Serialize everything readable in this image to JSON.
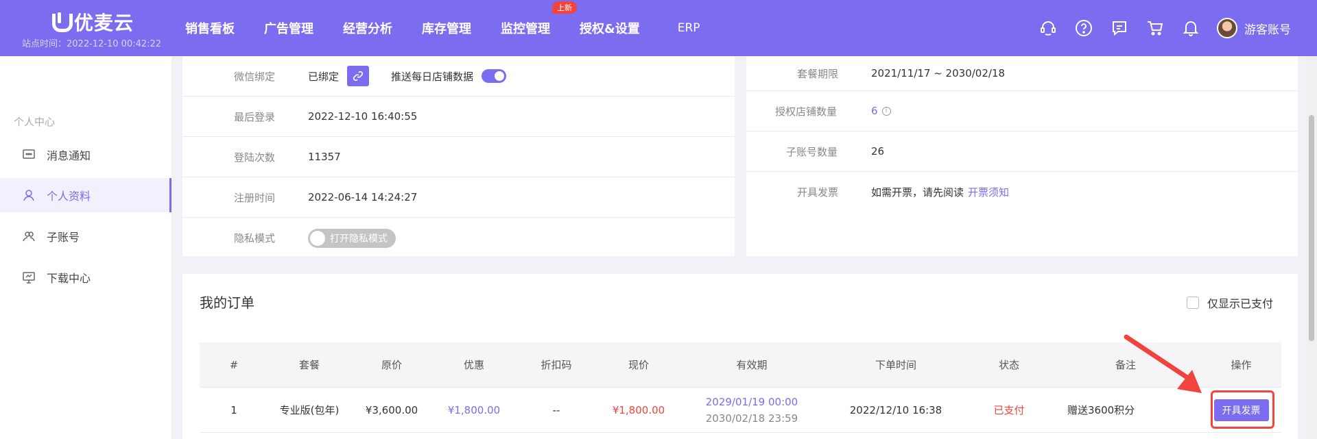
{
  "header": {
    "logo_text": "优麦云",
    "site_time": "站点时间：2022-12-10 00:42:22",
    "nav": [
      "销售看板",
      "广告管理",
      "经营分析",
      "库存管理",
      "监控管理",
      "授权&设置",
      "ERP"
    ],
    "new_badge": "上新",
    "account_name": "游客账号",
    "colors": {
      "header_bg": "#7b6cf0",
      "accent": "#7b6cf0",
      "danger": "#f0443d"
    }
  },
  "sidebar": {
    "section_title": "个人中心",
    "items": [
      {
        "label": "消息通知",
        "icon": "message-icon"
      },
      {
        "label": "个人资料",
        "icon": "user-icon"
      },
      {
        "label": "子账号",
        "icon": "users-icon"
      },
      {
        "label": "下载中心",
        "icon": "download-icon"
      }
    ],
    "active": "个人资料"
  },
  "profile": {
    "wechat": {
      "label": "微信绑定",
      "value": "已绑定",
      "push_label": "推送每日店铺数据",
      "push_on": true
    },
    "last_login": {
      "label": "最后登录",
      "value": "2022-12-10 16:40:55"
    },
    "login_count": {
      "label": "登陆次数",
      "value": "11357"
    },
    "register_time": {
      "label": "注册时间",
      "value": "2022-06-14 14:24:27"
    },
    "privacy": {
      "label": "隐私模式",
      "toggle_text": "打开隐私模式",
      "on": false
    }
  },
  "plan": {
    "period": {
      "label": "套餐期限",
      "value": "2021/11/17 ~ 2030/02/18"
    },
    "shops": {
      "label": "授权店铺数量",
      "value": "6"
    },
    "subaccounts": {
      "label": "子账号数量",
      "value": "26"
    },
    "invoice": {
      "label": "开具发票",
      "text": "如需开票，请先阅读",
      "link": "开票须知"
    }
  },
  "orders": {
    "title": "我的订单",
    "only_paid_label": "仅显示已支付",
    "columns": [
      "#",
      "套餐",
      "原价",
      "优惠",
      "折扣码",
      "现价",
      "有效期",
      "下单时间",
      "状态",
      "备注",
      "操作"
    ],
    "rows": [
      {
        "index": "1",
        "plan": "专业版(包年)",
        "original": "¥3,600.00",
        "discount": "¥1,800.00",
        "code": "--",
        "current": "¥1,800.00",
        "valid_from": "2029/01/19 00:00",
        "valid_to": "2030/02/18 23:59",
        "order_time": "2022/12/10 16:38",
        "status": "已支付",
        "note": "赠送3600积分",
        "action": "开具发票"
      }
    ]
  }
}
